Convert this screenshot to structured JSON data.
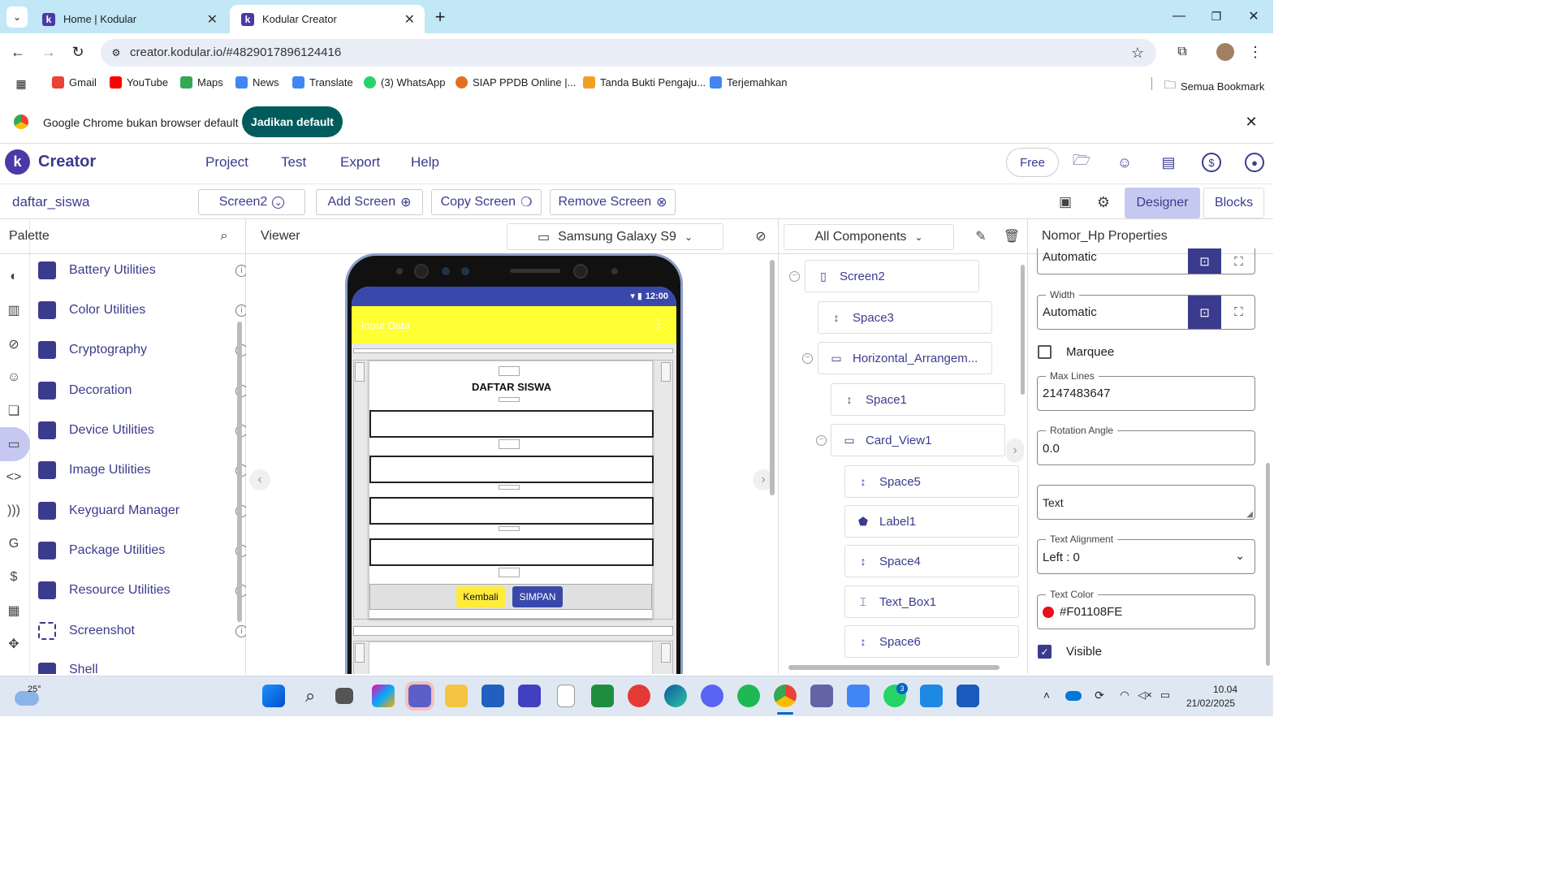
{
  "browser": {
    "tabs": [
      {
        "title": "Home | Kodular",
        "active": false
      },
      {
        "title": "Kodular Creator",
        "active": true
      }
    ],
    "url": "creator.kodular.io/#4829017896124416",
    "bookmarks": [
      "Gmail",
      "YouTube",
      "Maps",
      "News",
      "Translate",
      "(3) WhatsApp",
      "SIAP PPDB Online |...",
      "Tanda Bukti Pengaju...",
      "Terjemahkan"
    ],
    "all_bookmarks": "Semua Bookmark",
    "infobar": {
      "message": "Google Chrome bukan browser default",
      "button": "Jadikan default"
    }
  },
  "app": {
    "brand": "Creator",
    "menu": [
      "Project",
      "Test",
      "Export",
      "Help"
    ],
    "plan": "Free",
    "project_name": "daftar_siswa",
    "screen_select": "Screen2",
    "add_screen": "Add Screen",
    "copy_screen": "Copy Screen",
    "remove_screen": "Remove Screen",
    "designer_tab": "Designer",
    "blocks_tab": "Blocks"
  },
  "palette": {
    "title": "Palette",
    "items": [
      "Battery Utilities",
      "Color Utilities",
      "Cryptography",
      "Decoration",
      "Device Utilities",
      "Image Utilities",
      "Keyguard Manager",
      "Package Utilities",
      "Resource Utilities",
      "Screenshot",
      "Shell"
    ]
  },
  "viewer": {
    "title": "Viewer",
    "device": "Samsung Galaxy S9",
    "phone": {
      "time": "12:00",
      "appbar_title": "Input Data",
      "heading": "DAFTAR SISWA",
      "btn_back": "Kembali",
      "btn_save": "SIMPAN"
    }
  },
  "components": {
    "filter": "All Components",
    "tree": [
      {
        "name": "Screen2",
        "icon": "phone-icon"
      },
      {
        "name": "Space3",
        "icon": "space-icon"
      },
      {
        "name": "Horizontal_Arrangem...",
        "icon": "horizontal-arrangement-icon"
      },
      {
        "name": "Space1",
        "icon": "space-icon"
      },
      {
        "name": "Card_View1",
        "icon": "card-icon"
      },
      {
        "name": "Space5",
        "icon": "space-icon"
      },
      {
        "name": "Label1",
        "icon": "label-icon"
      },
      {
        "name": "Space4",
        "icon": "space-icon"
      },
      {
        "name": "Text_Box1",
        "icon": "textbox-icon"
      },
      {
        "name": "Space6",
        "icon": "space-icon"
      }
    ]
  },
  "properties": {
    "title": "Nomor_Hp Properties",
    "height_value": "Automatic",
    "width_label": "Width",
    "width_value": "Automatic",
    "marquee_label": "Marquee",
    "max_lines_label": "Max Lines",
    "max_lines_value": "2147483647",
    "rotation_label": "Rotation Angle",
    "rotation_value": "0.0",
    "text_value": "Text",
    "text_alignment_label": "Text Alignment",
    "text_alignment_value": "Left : 0",
    "text_color_label": "Text Color",
    "text_color_value": "#F01108FE",
    "text_color_swatch": "#e8101a",
    "visible_label": "Visible"
  },
  "taskbar": {
    "weather": "25°",
    "time": "10.04",
    "date": "21/02/2025",
    "teams_badge": "3"
  },
  "colors": {
    "accent": "#3b3b8e",
    "appbar_yellow": "#ffff33",
    "status_blue": "#3949ab",
    "designer_active": "#c5c8f0"
  }
}
